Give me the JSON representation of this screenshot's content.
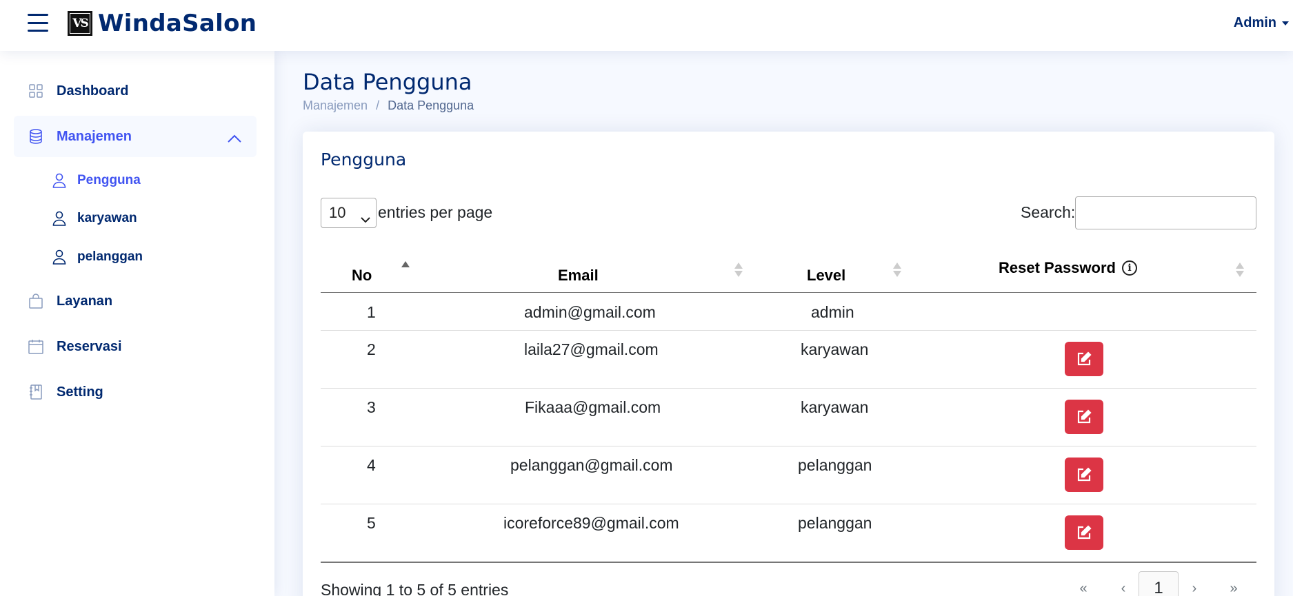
{
  "header": {
    "logo_text": "VS",
    "brand": "WindaSalon",
    "user_menu": "Admin"
  },
  "sidebar": {
    "items": [
      {
        "label": "Dashboard",
        "icon": "grid-icon"
      },
      {
        "label": "Manajemen",
        "icon": "database-icon",
        "expanded": true,
        "active": true
      },
      {
        "label": "Layanan",
        "icon": "bag-icon"
      },
      {
        "label": "Reservasi",
        "icon": "calendar-icon"
      },
      {
        "label": "Setting",
        "icon": "journal-icon"
      }
    ],
    "subitems": [
      {
        "label": "Pengguna",
        "icon": "person-icon",
        "active": true
      },
      {
        "label": "karyawan",
        "icon": "person-icon"
      },
      {
        "label": "pelanggan",
        "icon": "person-icon"
      }
    ]
  },
  "page": {
    "title": "Data Pengguna",
    "breadcrumb": [
      "Manajemen",
      "/",
      "Data Pengguna"
    ]
  },
  "card": {
    "title": "Pengguna",
    "per_page_value": "10",
    "per_page_label": "entries per page",
    "search_label": "Search:",
    "search_value": "",
    "columns": [
      "No",
      "Email",
      "Level",
      "Reset Password"
    ],
    "rows": [
      {
        "no": "1",
        "email": "admin@gmail.com",
        "level": "admin",
        "reset": false
      },
      {
        "no": "2",
        "email": "laila27@gmail.com",
        "level": "karyawan",
        "reset": true
      },
      {
        "no": "3",
        "email": "Fikaaa@gmail.com",
        "level": "karyawan",
        "reset": true
      },
      {
        "no": "4",
        "email": "pelanggan@gmail.com",
        "level": "pelanggan",
        "reset": true
      },
      {
        "no": "5",
        "email": "icoreforce89@gmail.com",
        "level": "pelanggan",
        "reset": true
      }
    ],
    "info": "Showing 1 to 5 of 5 entries",
    "pagination": [
      "«",
      "‹",
      "1",
      "›",
      "»"
    ]
  },
  "colors": {
    "primary": "#012970",
    "accent": "#4154f1",
    "danger": "#dc3545",
    "background": "#f6f9ff"
  }
}
